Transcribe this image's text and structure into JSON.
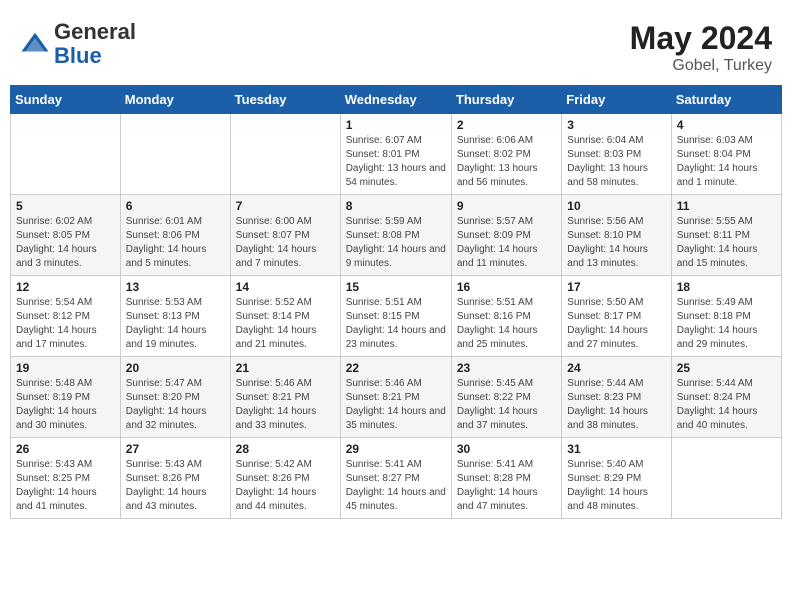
{
  "header": {
    "logo_general": "General",
    "logo_blue": "Blue",
    "month_year": "May 2024",
    "location": "Gobel, Turkey"
  },
  "days_of_week": [
    "Sunday",
    "Monday",
    "Tuesday",
    "Wednesday",
    "Thursday",
    "Friday",
    "Saturday"
  ],
  "weeks": [
    [
      {
        "day": "",
        "info": ""
      },
      {
        "day": "",
        "info": ""
      },
      {
        "day": "",
        "info": ""
      },
      {
        "day": "1",
        "info": "Sunrise: 6:07 AM\nSunset: 8:01 PM\nDaylight: 13 hours and 54 minutes."
      },
      {
        "day": "2",
        "info": "Sunrise: 6:06 AM\nSunset: 8:02 PM\nDaylight: 13 hours and 56 minutes."
      },
      {
        "day": "3",
        "info": "Sunrise: 6:04 AM\nSunset: 8:03 PM\nDaylight: 13 hours and 58 minutes."
      },
      {
        "day": "4",
        "info": "Sunrise: 6:03 AM\nSunset: 8:04 PM\nDaylight: 14 hours and 1 minute."
      }
    ],
    [
      {
        "day": "5",
        "info": "Sunrise: 6:02 AM\nSunset: 8:05 PM\nDaylight: 14 hours and 3 minutes."
      },
      {
        "day": "6",
        "info": "Sunrise: 6:01 AM\nSunset: 8:06 PM\nDaylight: 14 hours and 5 minutes."
      },
      {
        "day": "7",
        "info": "Sunrise: 6:00 AM\nSunset: 8:07 PM\nDaylight: 14 hours and 7 minutes."
      },
      {
        "day": "8",
        "info": "Sunrise: 5:59 AM\nSunset: 8:08 PM\nDaylight: 14 hours and 9 minutes."
      },
      {
        "day": "9",
        "info": "Sunrise: 5:57 AM\nSunset: 8:09 PM\nDaylight: 14 hours and 11 minutes."
      },
      {
        "day": "10",
        "info": "Sunrise: 5:56 AM\nSunset: 8:10 PM\nDaylight: 14 hours and 13 minutes."
      },
      {
        "day": "11",
        "info": "Sunrise: 5:55 AM\nSunset: 8:11 PM\nDaylight: 14 hours and 15 minutes."
      }
    ],
    [
      {
        "day": "12",
        "info": "Sunrise: 5:54 AM\nSunset: 8:12 PM\nDaylight: 14 hours and 17 minutes."
      },
      {
        "day": "13",
        "info": "Sunrise: 5:53 AM\nSunset: 8:13 PM\nDaylight: 14 hours and 19 minutes."
      },
      {
        "day": "14",
        "info": "Sunrise: 5:52 AM\nSunset: 8:14 PM\nDaylight: 14 hours and 21 minutes."
      },
      {
        "day": "15",
        "info": "Sunrise: 5:51 AM\nSunset: 8:15 PM\nDaylight: 14 hours and 23 minutes."
      },
      {
        "day": "16",
        "info": "Sunrise: 5:51 AM\nSunset: 8:16 PM\nDaylight: 14 hours and 25 minutes."
      },
      {
        "day": "17",
        "info": "Sunrise: 5:50 AM\nSunset: 8:17 PM\nDaylight: 14 hours and 27 minutes."
      },
      {
        "day": "18",
        "info": "Sunrise: 5:49 AM\nSunset: 8:18 PM\nDaylight: 14 hours and 29 minutes."
      }
    ],
    [
      {
        "day": "19",
        "info": "Sunrise: 5:48 AM\nSunset: 8:19 PM\nDaylight: 14 hours and 30 minutes."
      },
      {
        "day": "20",
        "info": "Sunrise: 5:47 AM\nSunset: 8:20 PM\nDaylight: 14 hours and 32 minutes."
      },
      {
        "day": "21",
        "info": "Sunrise: 5:46 AM\nSunset: 8:21 PM\nDaylight: 14 hours and 33 minutes."
      },
      {
        "day": "22",
        "info": "Sunrise: 5:46 AM\nSunset: 8:21 PM\nDaylight: 14 hours and 35 minutes."
      },
      {
        "day": "23",
        "info": "Sunrise: 5:45 AM\nSunset: 8:22 PM\nDaylight: 14 hours and 37 minutes."
      },
      {
        "day": "24",
        "info": "Sunrise: 5:44 AM\nSunset: 8:23 PM\nDaylight: 14 hours and 38 minutes."
      },
      {
        "day": "25",
        "info": "Sunrise: 5:44 AM\nSunset: 8:24 PM\nDaylight: 14 hours and 40 minutes."
      }
    ],
    [
      {
        "day": "26",
        "info": "Sunrise: 5:43 AM\nSunset: 8:25 PM\nDaylight: 14 hours and 41 minutes."
      },
      {
        "day": "27",
        "info": "Sunrise: 5:43 AM\nSunset: 8:26 PM\nDaylight: 14 hours and 43 minutes."
      },
      {
        "day": "28",
        "info": "Sunrise: 5:42 AM\nSunset: 8:26 PM\nDaylight: 14 hours and 44 minutes."
      },
      {
        "day": "29",
        "info": "Sunrise: 5:41 AM\nSunset: 8:27 PM\nDaylight: 14 hours and 45 minutes."
      },
      {
        "day": "30",
        "info": "Sunrise: 5:41 AM\nSunset: 8:28 PM\nDaylight: 14 hours and 47 minutes."
      },
      {
        "day": "31",
        "info": "Sunrise: 5:40 AM\nSunset: 8:29 PM\nDaylight: 14 hours and 48 minutes."
      },
      {
        "day": "",
        "info": ""
      }
    ]
  ]
}
